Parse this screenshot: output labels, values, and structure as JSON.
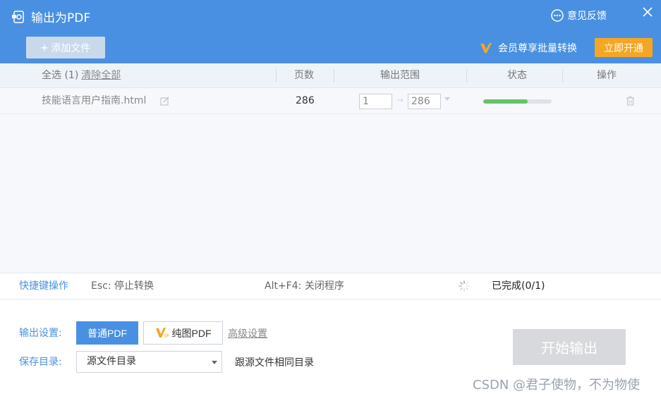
{
  "window": {
    "title": "输出为PDF",
    "feedback_label": "意见反馈"
  },
  "toolbar": {
    "add_file_label": "添加文件",
    "vip_promo": "会员尊享批量转换",
    "open_vip_label": "立即开通"
  },
  "table": {
    "select_all_label": "全选 (1)",
    "clear_all_label": "清除全部",
    "columns": [
      "页数",
      "输出范围",
      "状态",
      "操作"
    ],
    "rows": [
      {
        "file_name": "技能语言用户指南.html",
        "pages": "286",
        "range_from": "1",
        "range_to": "286",
        "progress": 0.65
      }
    ]
  },
  "shortcuts": {
    "title": "快捷键操作",
    "esc": "Esc: 停止转换",
    "alt_f4": "Alt+F4: 关闭程序",
    "status": "已完成(0/1)"
  },
  "settings": {
    "output_label": "输出设置:",
    "normal_pdf": "普通PDF",
    "image_pdf": "纯图PDF",
    "advanced": "高级设置",
    "save_label": "保存目录:",
    "save_dir": "源文件目录",
    "same_dir_note": "跟源文件相同目录",
    "start_label": "开始输出"
  },
  "watermark": "CSDN @君子使物，不为物使",
  "colors": {
    "accent": "#4a90e2",
    "vip_orange": "#f5a623",
    "progress_green": "#66c36a",
    "disabled_button": "#d7d9dc"
  }
}
